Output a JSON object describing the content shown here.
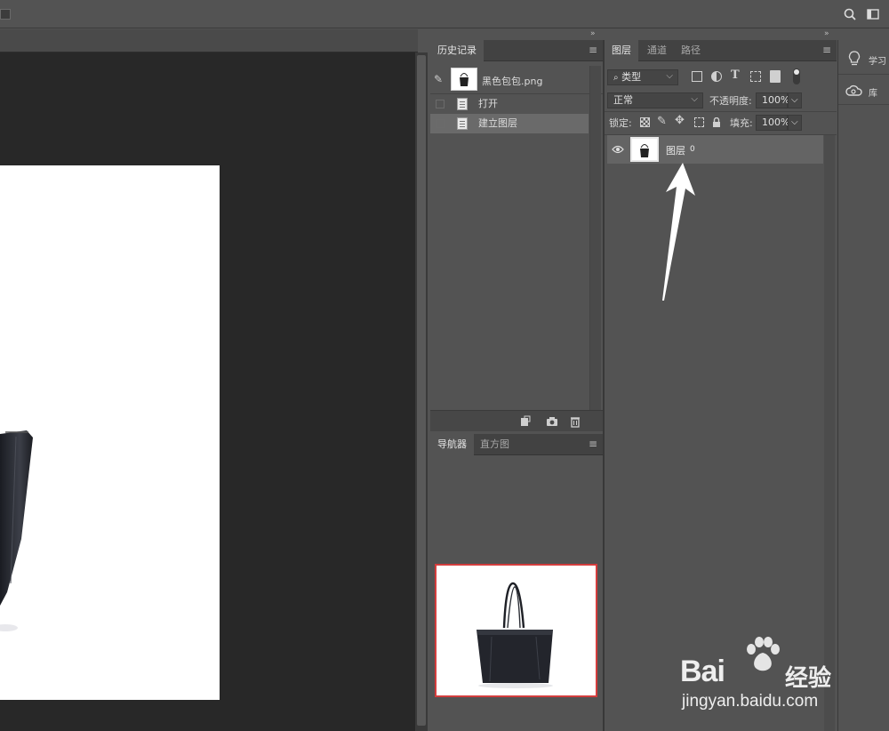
{
  "toolbar": {
    "search_icon": "search-icon",
    "workspace_icon": "workspace-icon"
  },
  "history_panel": {
    "tab_label": "历史记录",
    "snapshot_name": "黑色包包.png",
    "items": [
      {
        "label": "打开",
        "selected": false
      },
      {
        "label": "建立图层",
        "selected": true
      }
    ]
  },
  "layers_panel": {
    "tabs": [
      "图层",
      "通道",
      "路径"
    ],
    "filter_label": "类型",
    "blend_mode": "正常",
    "opacity_label": "不透明度:",
    "opacity_value": "100%",
    "lock_label": "锁定:",
    "fill_label": "填充:",
    "fill_value": "100%",
    "layer_name": "图层",
    "layer_index": "0"
  },
  "navigator_panel": {
    "tabs": [
      "导航器",
      "直方图"
    ]
  },
  "side_panel": {
    "learn_label": "学习",
    "library_label": "库"
  },
  "watermark": {
    "line1_a": "Bai",
    "line1_b": "经验",
    "line2": "jingyan.baidu.com"
  },
  "colors": {
    "panel_bg": "#535353",
    "canvas_bg": "#282828",
    "selection": "#6a6a6a",
    "nav_frame": "#d33d3d"
  }
}
